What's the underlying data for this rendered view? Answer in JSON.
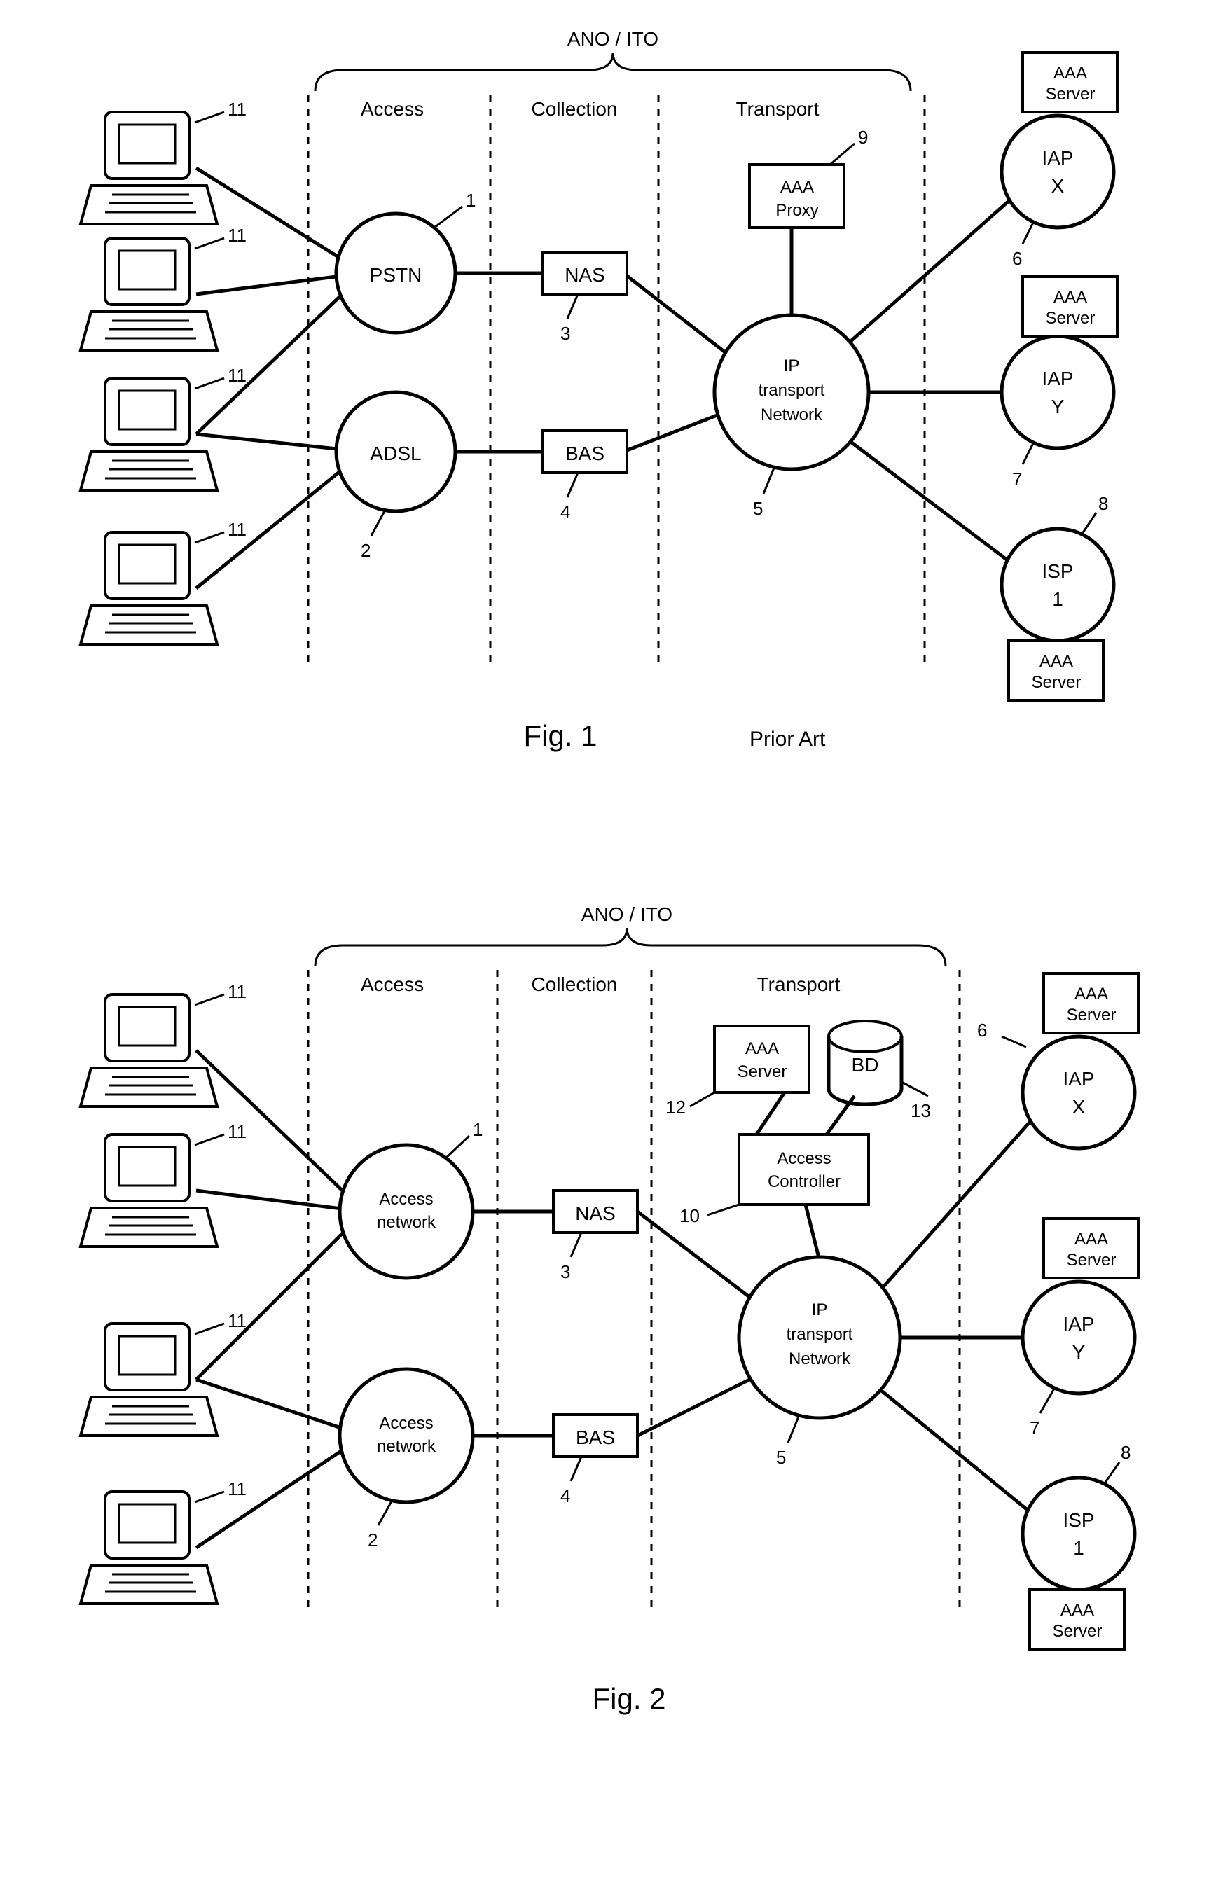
{
  "fig1": {
    "header": "ANO / ITO",
    "cols": {
      "access": "Access",
      "collection": "Collection",
      "transport": "Transport"
    },
    "pstn": "PSTN",
    "adsl": "ADSL",
    "nas": "NAS",
    "bas": "BAS",
    "iptn_l1": "IP",
    "iptn_l2": "transport",
    "iptn_l3": "Network",
    "aaa_proxy_l1": "AAA",
    "aaa_proxy_l2": "Proxy",
    "iap_x_l1": "IAP",
    "iap_x_l2": "X",
    "iap_y_l1": "IAP",
    "iap_y_l2": "Y",
    "isp_l1": "ISP",
    "isp_l2": "1",
    "aaa_srv_l1": "AAA",
    "aaa_srv_l2": "Server",
    "nums": {
      "n1": "1",
      "n2": "2",
      "n3": "3",
      "n4": "4",
      "n5": "5",
      "n6": "6",
      "n7": "7",
      "n8": "8",
      "n9": "9",
      "n11": "11"
    },
    "title": "Fig. 1",
    "subtitle": "Prior Art"
  },
  "fig2": {
    "header": "ANO / ITO",
    "cols": {
      "access": "Access",
      "collection": "Collection",
      "transport": "Transport"
    },
    "access_net_l1": "Access",
    "access_net_l2": "network",
    "nas": "NAS",
    "bas": "BAS",
    "iptn_l1": "IP",
    "iptn_l2": "transport",
    "iptn_l3": "Network",
    "aaa_srv_l1": "AAA",
    "aaa_srv_l2": "Server",
    "bd": "BD",
    "acc_ctrl_l1": "Access",
    "acc_ctrl_l2": "Controller",
    "iap_x_l1": "IAP",
    "iap_x_l2": "X",
    "iap_y_l1": "IAP",
    "iap_y_l2": "Y",
    "isp_l1": "ISP",
    "isp_l2": "1",
    "nums": {
      "n1": "1",
      "n2": "2",
      "n3": "3",
      "n4": "4",
      "n5": "5",
      "n6": "6",
      "n7": "7",
      "n8": "8",
      "n10": "10",
      "n11": "11",
      "n12": "12",
      "n13": "13"
    },
    "title": "Fig. 2"
  }
}
